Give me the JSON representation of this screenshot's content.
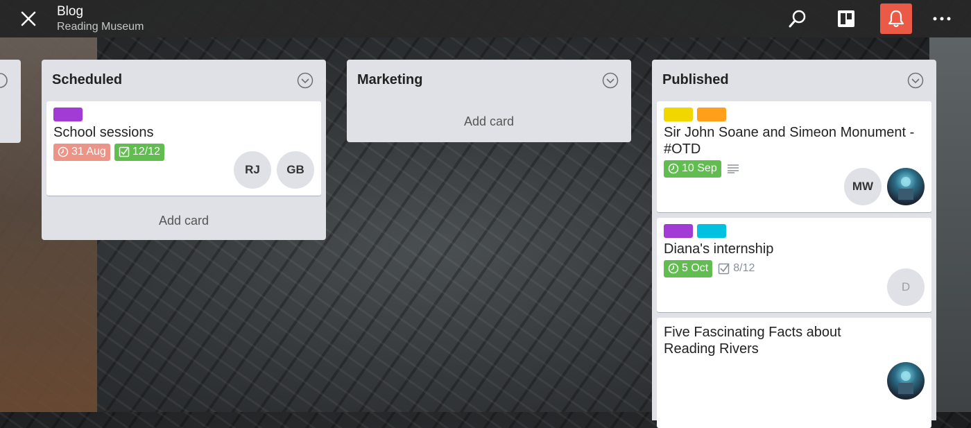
{
  "header": {
    "title": "Blog",
    "subtitle": "Reading Museum",
    "icons": {
      "close": "close-icon",
      "search": "search-icon",
      "board": "board-icon",
      "notifications": "bell-icon",
      "more": "more-icon"
    },
    "notification_color": "#eb5a46"
  },
  "lists": {
    "scheduled": {
      "title": "Scheduled",
      "add_card": "Add card",
      "cards": [
        {
          "title": "School sessions",
          "labels": [
            "#a23bd6"
          ],
          "due": "31 Aug",
          "checklist": "12/12",
          "members": [
            "RJ",
            "GB"
          ]
        }
      ]
    },
    "marketing": {
      "title": "Marketing",
      "add_card": "Add card"
    },
    "published": {
      "title": "Published",
      "cards": [
        {
          "title": "Sir John Soane and Simeon Monument - #OTD",
          "labels": [
            "#f2d600",
            "#ff9f1a"
          ],
          "due": "10 Sep",
          "has_description": true,
          "members": [
            "MW"
          ]
        },
        {
          "title": "Diana's internship",
          "labels": [
            "#a23bd6",
            "#00c2e0"
          ],
          "due": "5 Oct",
          "checklist": "8/12",
          "members": [
            "D"
          ]
        },
        {
          "title": "Five Fascinating Facts about Reading Rivers",
          "labels": [],
          "members": []
        }
      ]
    }
  },
  "colors": {
    "label_purple": "#a23bd6",
    "label_yellow": "#f2d600",
    "label_orange": "#ff9f1a",
    "label_blue": "#00c2e0",
    "due_overdue": "#ec9488",
    "due_complete": "#61bd4f"
  }
}
